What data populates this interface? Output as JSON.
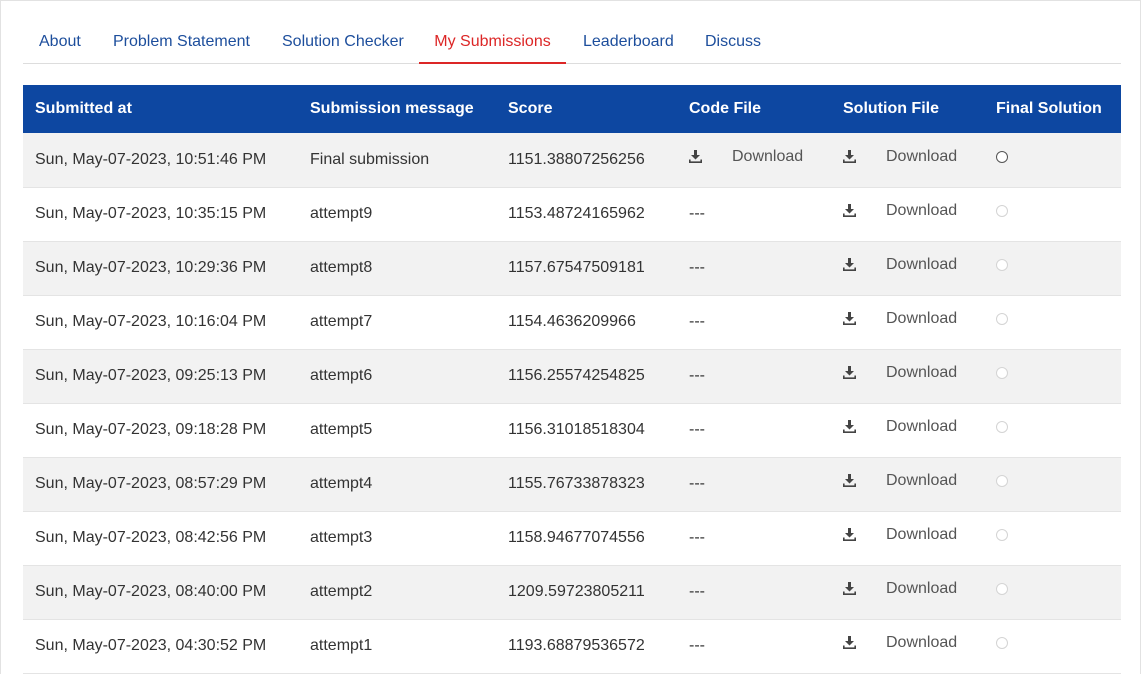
{
  "tabs": [
    {
      "label": "About",
      "active": false
    },
    {
      "label": "Problem Statement",
      "active": false
    },
    {
      "label": "Solution Checker",
      "active": false
    },
    {
      "label": "My Submissions",
      "active": true
    },
    {
      "label": "Leaderboard",
      "active": false
    },
    {
      "label": "Discuss",
      "active": false
    }
  ],
  "colors": {
    "header_bg": "#0d47a1",
    "tab_link": "#1d4e9c",
    "tab_active": "#dc2626",
    "row_stripe": "#f2f2f2"
  },
  "table": {
    "headers": {
      "submitted_at": "Submitted at",
      "message": "Submission message",
      "score": "Score",
      "code_file": "Code File",
      "solution_file": "Solution File",
      "final_solution": "Final Solution"
    },
    "download_label": "Download",
    "download_icon": "download-icon",
    "empty_placeholder": "---",
    "rows": [
      {
        "submitted_at": "Sun, May-07-2023, 10:51:46 PM",
        "message": "Final submission",
        "score": "1151.38807256256",
        "code_file": "Download",
        "solution_file": "Download",
        "final_enabled": true
      },
      {
        "submitted_at": "Sun, May-07-2023, 10:35:15 PM",
        "message": "attempt9",
        "score": "1153.48724165962",
        "code_file": "---",
        "solution_file": "Download",
        "final_enabled": false
      },
      {
        "submitted_at": "Sun, May-07-2023, 10:29:36 PM",
        "message": "attempt8",
        "score": "1157.67547509181",
        "code_file": "---",
        "solution_file": "Download",
        "final_enabled": false
      },
      {
        "submitted_at": "Sun, May-07-2023, 10:16:04 PM",
        "message": "attempt7",
        "score": "1154.4636209966",
        "code_file": "---",
        "solution_file": "Download",
        "final_enabled": false
      },
      {
        "submitted_at": "Sun, May-07-2023, 09:25:13 PM",
        "message": "attempt6",
        "score": "1156.25574254825",
        "code_file": "---",
        "solution_file": "Download",
        "final_enabled": false
      },
      {
        "submitted_at": "Sun, May-07-2023, 09:18:28 PM",
        "message": "attempt5",
        "score": "1156.31018518304",
        "code_file": "---",
        "solution_file": "Download",
        "final_enabled": false
      },
      {
        "submitted_at": "Sun, May-07-2023, 08:57:29 PM",
        "message": "attempt4",
        "score": "1155.76733878323",
        "code_file": "---",
        "solution_file": "Download",
        "final_enabled": false
      },
      {
        "submitted_at": "Sun, May-07-2023, 08:42:56 PM",
        "message": "attempt3",
        "score": "1158.94677074556",
        "code_file": "---",
        "solution_file": "Download",
        "final_enabled": false
      },
      {
        "submitted_at": "Sun, May-07-2023, 08:40:00 PM",
        "message": "attempt2",
        "score": "1209.59723805211",
        "code_file": "---",
        "solution_file": "Download",
        "final_enabled": false
      },
      {
        "submitted_at": "Sun, May-07-2023, 04:30:52 PM",
        "message": "attempt1",
        "score": "1193.68879536572",
        "code_file": "---",
        "solution_file": "Download",
        "final_enabled": false
      }
    ]
  }
}
